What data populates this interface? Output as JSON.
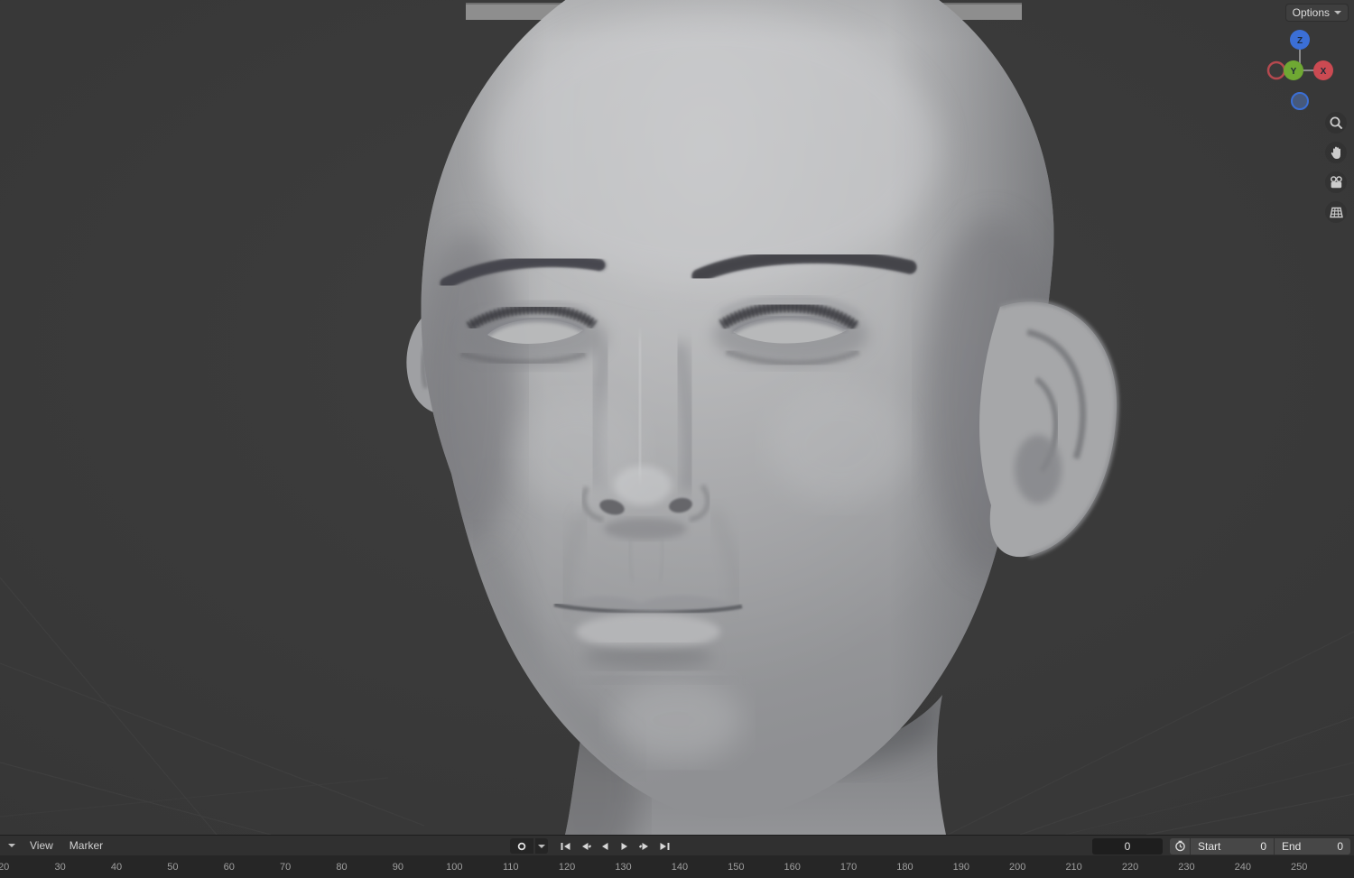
{
  "viewport": {
    "options_label": "Options",
    "gizmo": {
      "z": "Z",
      "y": "Y",
      "x": "X"
    },
    "tools": [
      "zoom",
      "pan-view",
      "camera-view",
      "toggle-grid"
    ]
  },
  "timeline": {
    "menus": [
      "View",
      "Marker"
    ],
    "record": "auto-keying-record",
    "transport": [
      "jump-to-start",
      "jump-to-previous-keyframe",
      "play-reverse",
      "play",
      "jump-to-next-keyframe",
      "jump-to-end"
    ],
    "current_frame": "0",
    "start_label": "Start",
    "start_value": "0",
    "end_label": "End",
    "end_value": "0",
    "ruler_frames": [
      20,
      30,
      40,
      50,
      60,
      70,
      80,
      90,
      100,
      110,
      120,
      130,
      140,
      150,
      160,
      170,
      180,
      190,
      200,
      210,
      220,
      230,
      240,
      250
    ]
  },
  "colors": {
    "axis_x": "#cb4a52",
    "axis_y": "#6fa833",
    "axis_z": "#3b6fd6",
    "viewport_bg": "#3a3a3a",
    "backdrop_band": "#8e8e8e"
  }
}
